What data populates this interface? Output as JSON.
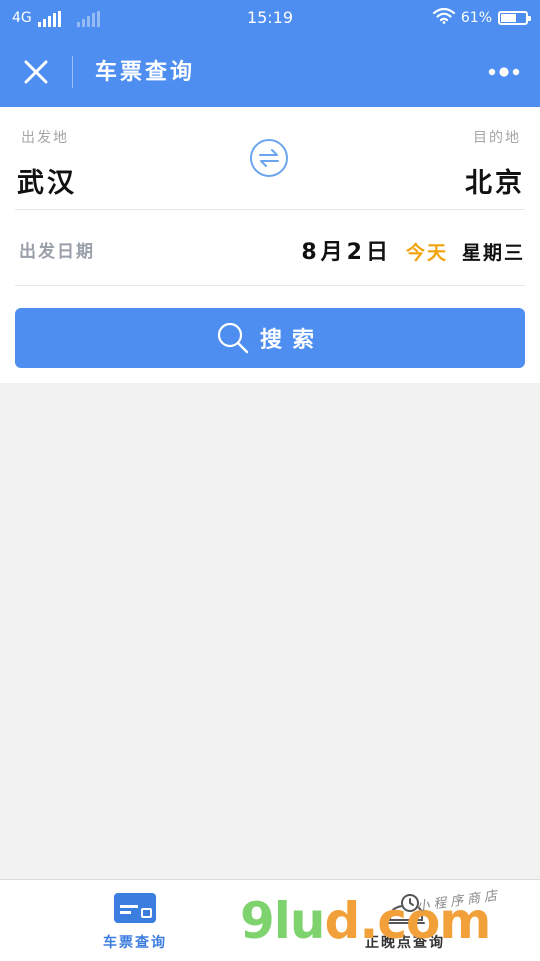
{
  "status_bar": {
    "network": "4G",
    "time": "15:19",
    "battery_percent_text": "61%",
    "battery_level": 0.61
  },
  "header": {
    "title": "车票查询"
  },
  "form": {
    "from_caption": "出发地",
    "from_station": "武汉",
    "to_caption": "目的地",
    "to_station": "北京",
    "date_caption": "出发日期",
    "date_value": "8月2日",
    "date_today": "今天",
    "date_weekday": "星期三"
  },
  "search": {
    "label": "搜索"
  },
  "tabbar": {
    "tabs": [
      {
        "label": "车票查询",
        "icon": "ticket-card-icon",
        "active": true
      },
      {
        "label": "正晚点查询",
        "icon": "delay-query-icon",
        "active": false
      }
    ]
  },
  "watermark": {
    "logo_green": "9lu",
    "logo_orange": "d.com",
    "tagline": "小程序商店"
  },
  "colors": {
    "primary": "#4d8ef0",
    "today": "#f0a30a",
    "background": "#f2f2f2"
  }
}
